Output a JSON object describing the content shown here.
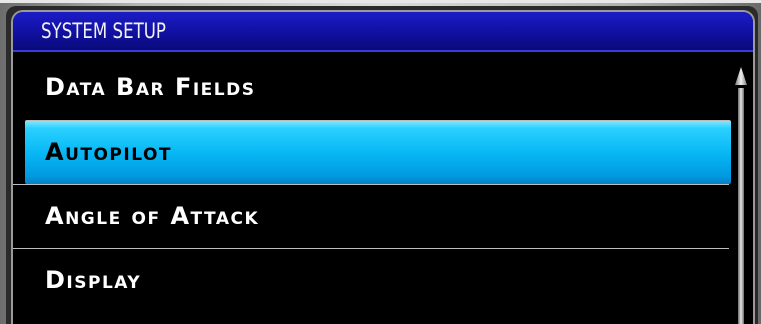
{
  "window": {
    "title": "SYSTEM SETUP"
  },
  "menu": {
    "items": [
      {
        "label": "Data Bar Fields",
        "selected": false
      },
      {
        "label": "Autopilot",
        "selected": true
      },
      {
        "label": "Angle of Attack",
        "selected": false
      },
      {
        "label": "Display",
        "selected": false
      }
    ]
  },
  "colors": {
    "title_bar": "#1010a0",
    "selection": "#08b8f4",
    "background": "#000000",
    "text": "#ffffff"
  },
  "icons": {
    "scroll_up": "scroll-up-arrow-icon"
  }
}
